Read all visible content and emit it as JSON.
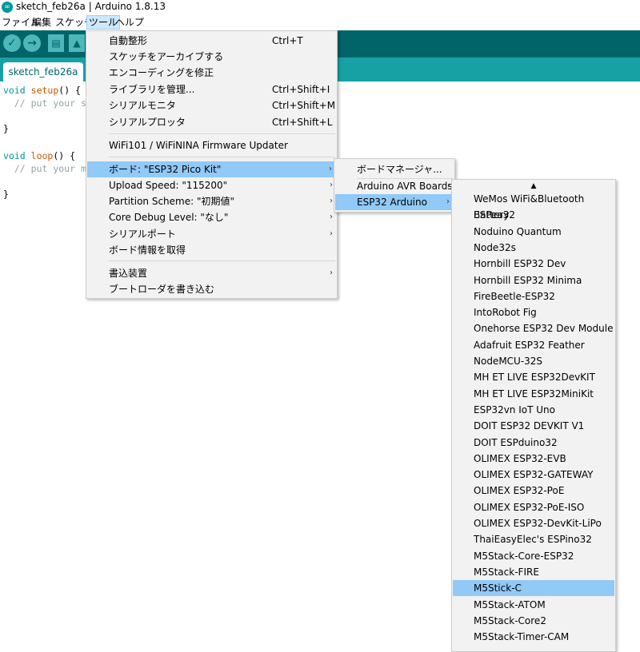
{
  "window": {
    "title": "sketch_feb26a | Arduino 1.8.13"
  },
  "menubar": [
    {
      "label": "ファイル"
    },
    {
      "label": "編集"
    },
    {
      "label": "スケッチ"
    },
    {
      "label": "ツール"
    },
    {
      "label": "ヘルプ"
    }
  ],
  "tab": {
    "label": "sketch_feb26a"
  },
  "code": [
    {
      "kw": "void",
      "fn": "setup",
      "rest": "() {"
    },
    {
      "comment": "// put your s"
    },
    {
      "plain": "}"
    },
    {
      "kw": "void",
      "fn": "loop",
      "rest": "() {"
    },
    {
      "comment": "// put your m"
    },
    {
      "plain": "}"
    }
  ],
  "tools_menu": {
    "items": [
      {
        "label": "自動整形",
        "shortcut": "Ctrl+T"
      },
      {
        "label": "スケッチをアーカイブする",
        "shortcut": ""
      },
      {
        "label": "エンコーディングを修正",
        "shortcut": ""
      },
      {
        "label": "ライブラリを管理...",
        "shortcut": "Ctrl+Shift+I"
      },
      {
        "label": "シリアルモニタ",
        "shortcut": "Ctrl+Shift+M"
      },
      {
        "label": "シリアルプロッタ",
        "shortcut": "Ctrl+Shift+L"
      },
      {
        "label": "WiFi101 / WiFiNINA Firmware Updater",
        "shortcut": ""
      },
      {
        "label": "ボード: \"ESP32 Pico Kit\"",
        "shortcut": ""
      },
      {
        "label": "Upload Speed: \"115200\"",
        "shortcut": ""
      },
      {
        "label": "Partition Scheme: \"初期値\"",
        "shortcut": ""
      },
      {
        "label": "Core Debug Level: \"なし\"",
        "shortcut": ""
      },
      {
        "label": "シリアルポート",
        "shortcut": ""
      },
      {
        "label": "ボード情報を取得",
        "shortcut": ""
      },
      {
        "label": "書込装置",
        "shortcut": ""
      },
      {
        "label": "ブートローダを書き込む",
        "shortcut": ""
      }
    ]
  },
  "board_menu": {
    "items": [
      {
        "label": "ボードマネージャ..."
      },
      {
        "label": "Arduino AVR Boards"
      },
      {
        "label": "ESP32 Arduino"
      }
    ]
  },
  "esp32_boards": {
    "scroll_up": "▲",
    "items": [
      "WeMos WiFi&Bluetooth Battery",
      "ESPea32",
      "Noduino Quantum",
      "Node32s",
      "Hornbill ESP32 Dev",
      "Hornbill ESP32 Minima",
      "FireBeetle-ESP32",
      "IntoRobot Fig",
      "Onehorse ESP32 Dev Module",
      "Adafruit ESP32 Feather",
      "NodeMCU-32S",
      "MH ET LIVE ESP32DevKIT",
      "MH ET LIVE ESP32MiniKit",
      "ESP32vn IoT Uno",
      "DOIT ESP32 DEVKIT V1",
      "DOIT ESPduino32",
      "OLIMEX ESP32-EVB",
      "OLIMEX ESP32-GATEWAY",
      "OLIMEX ESP32-PoE",
      "OLIMEX ESP32-PoE-ISO",
      "OLIMEX ESP32-DevKit-LiPo",
      "ThaiEasyElec's ESPino32",
      "M5Stack-Core-ESP32",
      "M5Stack-FIRE",
      "M5Stick-C",
      "M5Stack-ATOM",
      "M5Stack-Core2",
      "M5Stack-Timer-CAM"
    ],
    "selected": "M5Stick-C"
  },
  "colors": {
    "toolbar": "#006468",
    "tabbar": "#17a1a5",
    "highlight": "#91c9f7"
  }
}
